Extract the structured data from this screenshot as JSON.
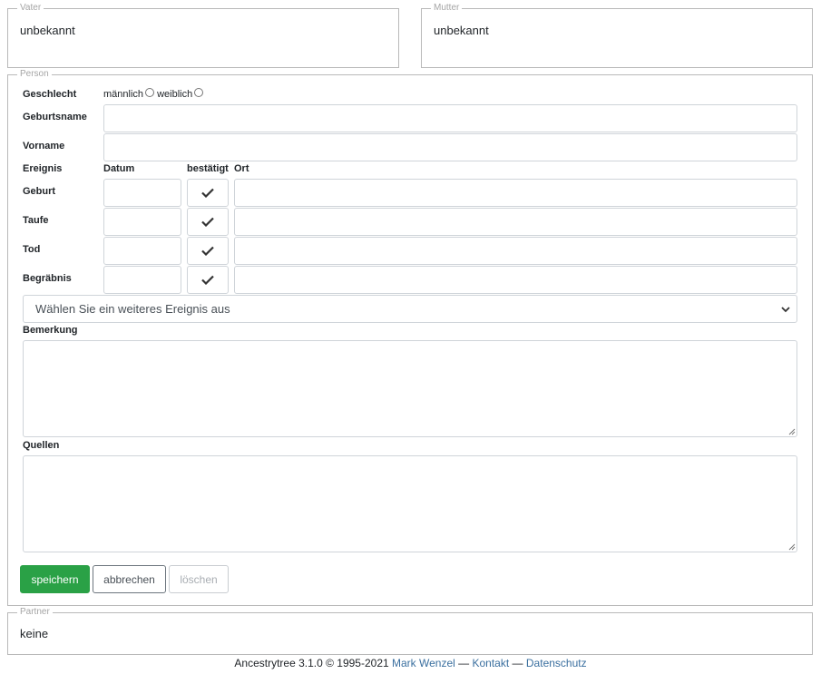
{
  "father": {
    "legend": "Vater",
    "value": "unbekannt"
  },
  "mother": {
    "legend": "Mutter",
    "value": "unbekannt"
  },
  "person": {
    "legend": "Person",
    "gender_label": "Geschlecht",
    "gender_male": "männlich",
    "gender_female": "weiblich",
    "birthname_label": "Geburtsname",
    "firstname_label": "Vorname",
    "events_header": {
      "event": "Ereignis",
      "date": "Datum",
      "confirmed": "bestätigt",
      "place": "Ort"
    },
    "events": [
      {
        "name": "Geburt",
        "date": "",
        "place": "",
        "confirmed": true
      },
      {
        "name": "Taufe",
        "date": "",
        "place": "",
        "confirmed": true
      },
      {
        "name": "Tod",
        "date": "",
        "place": "",
        "confirmed": true
      },
      {
        "name": "Begräbnis",
        "date": "",
        "place": "",
        "confirmed": true
      }
    ],
    "event_select": "Wählen Sie ein weiteres Ereignis aus",
    "remark_label": "Bemerkung",
    "sources_label": "Quellen"
  },
  "actions": {
    "save": "speichern",
    "cancel": "abbrechen",
    "delete": "löschen"
  },
  "partner": {
    "legend": "Partner",
    "value": "keine"
  },
  "footer": {
    "text": "Ancestrytree 3.1.0 © 1995-2021",
    "author_link": "Mark Wenzel",
    "sep1": "—",
    "contact_link": "Kontakt",
    "sep2": "—",
    "privacy_link": "Datenschutz"
  },
  "colors": {
    "save_button": "#2aa146",
    "link": "#3a6f9f",
    "border": "#b9b9b9"
  }
}
